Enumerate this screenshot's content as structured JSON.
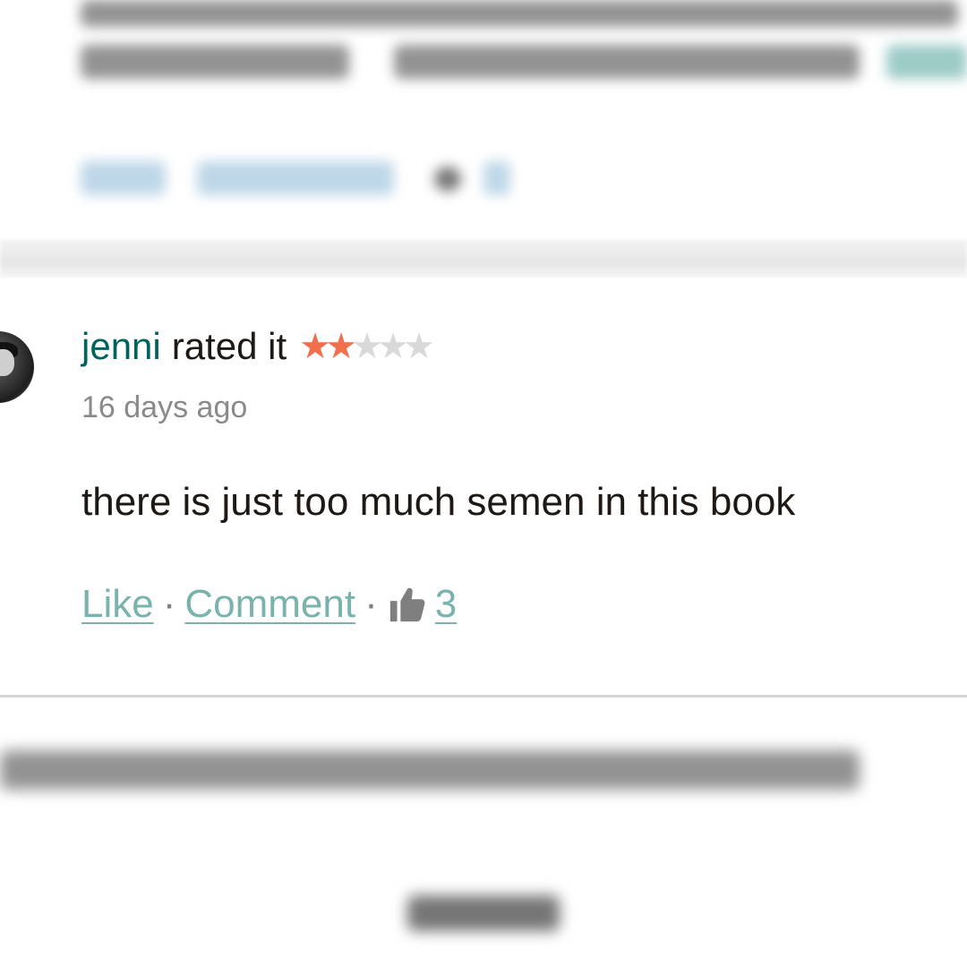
{
  "review": {
    "username": "jenni",
    "rated_text": "rated it",
    "rating": 2,
    "max_rating": 5,
    "timestamp": "16 days ago",
    "body": "there is just too much semen in this book",
    "like_label": "Like",
    "comment_label": "Comment",
    "separator": "·",
    "likes_count": "3"
  },
  "icons": {
    "star_filled": "star-icon",
    "star_empty": "star-outline-icon",
    "likes": "thumbs-up-icon"
  },
  "colors": {
    "username": "#00635d",
    "star_filled": "#f06f4c",
    "star_empty": "#d9d9d9",
    "link": "#7ab2ad",
    "body_text": "#1e1915",
    "muted_text": "#8a8a8a"
  }
}
